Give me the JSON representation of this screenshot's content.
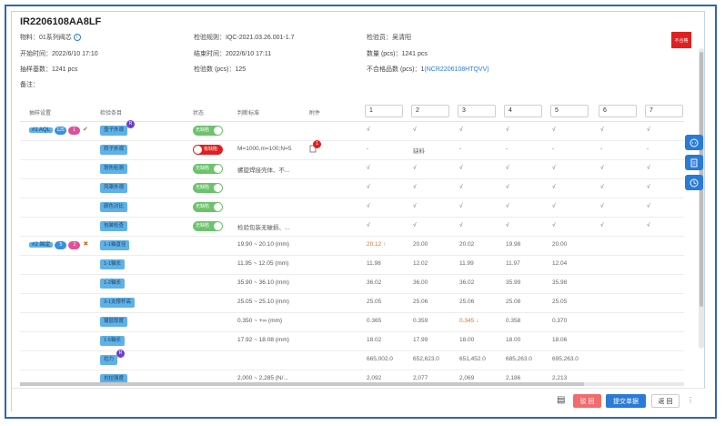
{
  "header": {
    "title": "IR2206108AA8LF",
    "reject_badge": "不合格",
    "material_label": "物料：",
    "material_value": "01系列阀芯",
    "rule_label": "检验规则：",
    "rule_value": "IQC-2021.03.26.001-1.7",
    "inspector_label": "检验员：",
    "inspector_value": "吴清阳",
    "start_label": "开始时间：",
    "start_value": "2022/6/10 17:10",
    "end_label": "结束时间：",
    "end_value": "2022/6/10 17:11",
    "qty_label": "数量 (pcs)：",
    "qty_value": "1241 pcs",
    "sample_base_label": "抽样基数：",
    "sample_base_value": "1241 pcs",
    "inspect_qty_label": "检验数 (pcs)：",
    "inspect_qty_value": "125",
    "nc_label": "不合格品数 (pcs)：",
    "nc_value": "1",
    "nc_link": "(NCR2206108HTQVV)",
    "remark_label": "备注："
  },
  "table": {
    "headers": {
      "plan": "抽样设置",
      "item": "检验条目",
      "state": "状态",
      "std": "判断标准",
      "attach": "附件"
    },
    "columns": [
      "1",
      "2",
      "3",
      "4",
      "5",
      "6",
      "7"
    ],
    "groups": [
      {
        "label": "#1 AQL",
        "pill_a": "125",
        "pill_b": "1",
        "row": 0
      },
      {
        "label": "#2 固定",
        "pill_a": "5",
        "pill_b": "2",
        "row": 6
      }
    ],
    "toggle_on": "无缺陷",
    "toggle_bad": "有缺陷",
    "r_badge": "R",
    "attach_count": "1",
    "rows": [
      {
        "item": "壶子外观",
        "badge": true,
        "state": "on",
        "std": "",
        "attach": false,
        "vals": [
          "√",
          "√",
          "√",
          "√",
          "√",
          "√",
          "√"
        ]
      },
      {
        "item": "转子外观",
        "badge": false,
        "state": "bad",
        "std": "M=1000,m=100;N=5",
        "attach": true,
        "vals": [
          "-",
          "缺料",
          "-",
          "-",
          "-",
          "-",
          "-"
        ]
      },
      {
        "item": "划伤检测",
        "badge": false,
        "state": "on",
        "std": "螺旋焊接壳体、不...",
        "attach": false,
        "vals": [
          "√",
          "√",
          "√",
          "√",
          "√",
          "√",
          "√"
        ]
      },
      {
        "item": "风罩外观",
        "badge": false,
        "state": "on",
        "std": "",
        "attach": false,
        "vals": [
          "√",
          "√",
          "√",
          "√",
          "√",
          "√",
          "√"
        ]
      },
      {
        "item": "颜色对比",
        "badge": false,
        "state": "on",
        "std": "",
        "attach": false,
        "vals": [
          "√",
          "√",
          "√",
          "√",
          "√",
          "√",
          "√"
        ]
      },
      {
        "item": "包装检查",
        "badge": false,
        "state": "on",
        "std": "检验包装无破损、...",
        "attach": false,
        "vals": [
          "√",
          "√",
          "√",
          "√",
          "√",
          "√",
          "√"
        ]
      },
      {
        "item": "1-1轴直径",
        "badge": false,
        "state": "",
        "std": "19.90 ~ 20.10 (mm)",
        "attach": false,
        "vals": [
          "20.12 ↑",
          "20.00",
          "20.02",
          "19.98",
          "20.00",
          "",
          ""
        ],
        "red": [
          0
        ]
      },
      {
        "item": "1-1轴长",
        "badge": false,
        "state": "",
        "std": "11.95 ~ 12.05 (mm)",
        "attach": false,
        "vals": [
          "11.98",
          "12.02",
          "11.99",
          "11.97",
          "12.04",
          "",
          ""
        ]
      },
      {
        "item": "1-2轴长",
        "badge": false,
        "state": "",
        "std": "35.90 ~ 36.10 (mm)",
        "attach": false,
        "vals": [
          "36.02",
          "36.00",
          "36.02",
          "35.99",
          "35.98",
          "",
          ""
        ]
      },
      {
        "item": "3-1支撑杆高",
        "badge": false,
        "state": "",
        "std": "25.05 ~ 25.10 (mm)",
        "attach": false,
        "vals": [
          "25.05",
          "25.06",
          "25.06",
          "25.08",
          "25.05",
          "",
          ""
        ]
      },
      {
        "item": "镀层厚度",
        "badge": false,
        "state": "",
        "std": "0.350 ~ +∞ (mm)",
        "attach": false,
        "vals": [
          "0.365",
          "0.359",
          "0.345 ↓",
          "0.358",
          "0.370",
          "",
          ""
        ],
        "red": [
          2
        ]
      },
      {
        "item": "1-5轴长",
        "badge": false,
        "state": "",
        "std": "17.92 ~ 18.08 (mm)",
        "attach": false,
        "vals": [
          "18.02",
          "17.99",
          "18.00",
          "18.00",
          "18.06",
          "",
          ""
        ]
      },
      {
        "item": "拉力",
        "badge": true,
        "state": "",
        "std": "",
        "attach": false,
        "vals": [
          "665,002.0",
          "652,623.0",
          "651,452.0",
          "685,263.0",
          "695,263.0",
          "",
          ""
        ]
      },
      {
        "item": "抗拉强度",
        "badge": false,
        "state": "",
        "std": "2,000 ~ 2,285 (N/...",
        "attach": false,
        "vals": [
          "2,092",
          "2,077",
          "2,069",
          "2,186",
          "2,213",
          "",
          ""
        ]
      }
    ]
  },
  "footer": {
    "reject": "驳 回",
    "submit": "提交单据",
    "back": "返 回",
    "more": "⋮",
    "list_icon": "▤"
  },
  "colors": {
    "accent": "#2a7ad8",
    "reject": "#e02020",
    "ok": "#6cc36c",
    "chip": "#5fb1e6"
  }
}
